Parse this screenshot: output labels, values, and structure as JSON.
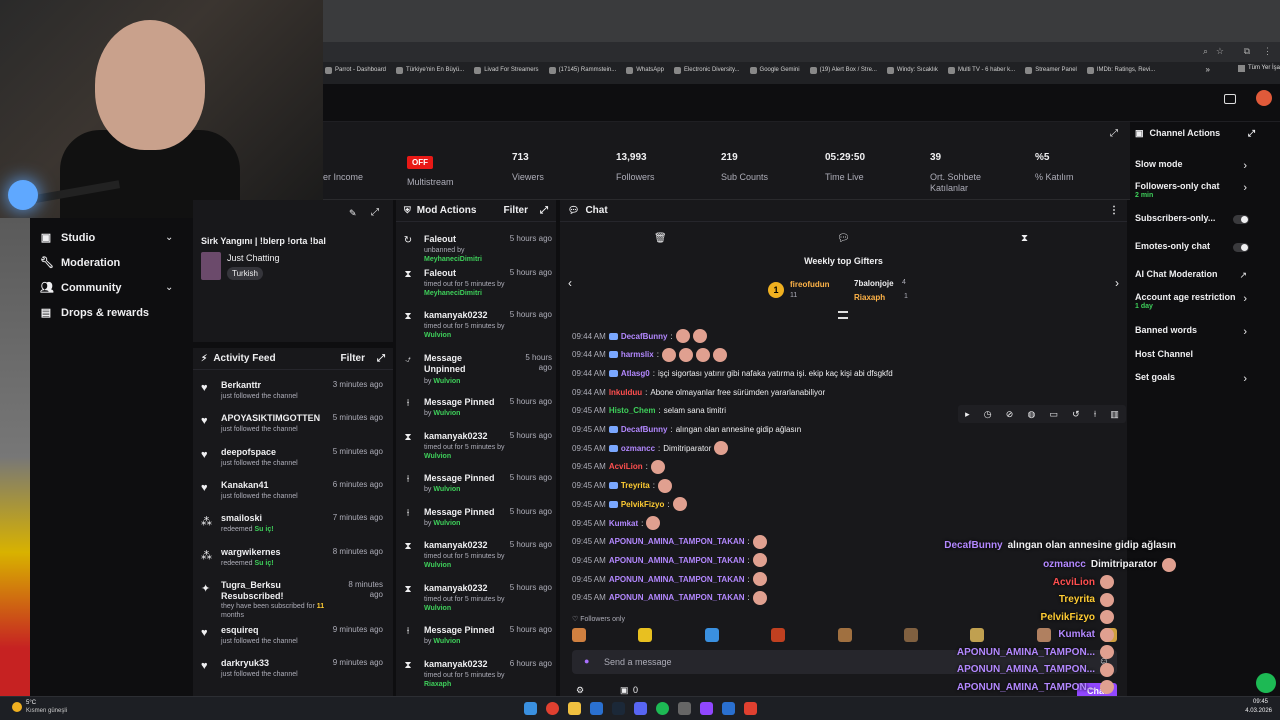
{
  "browser": {
    "bookmarks": [
      "Parrot - Dashboard",
      "Türkiye'nin En Büyü...",
      "Livad For Streamers",
      "(17145) Rammstein...",
      "WhatsApp",
      "Electronic Diversity...",
      "Google Gemini",
      "(19) Alert Box / Stre...",
      "Windy: Sıcaklık",
      "Multi TV - 6 haber k...",
      "Streamer Panel",
      "IMDb: Ratings, Revi..."
    ],
    "more": "»",
    "other_bookmarks": "Tüm Yer İşa"
  },
  "stats": {
    "income_label": "er Income",
    "multistream_badge": "OFF",
    "multistream_label": "Multistream",
    "viewers": "713",
    "viewers_label": "Viewers",
    "followers": "13,993",
    "followers_label": "Followers",
    "subs": "219",
    "subs_label": "Sub Counts",
    "time_live": "05:29:50",
    "time_live_label": "Time Live",
    "avg_chat": "39",
    "avg_chat_label": "Ort. Sohbete Katılanlar",
    "participation": "%5",
    "participation_label": "% Katılım"
  },
  "sidebar": {
    "items": [
      {
        "label": "Studio",
        "icon": "video-icon"
      },
      {
        "label": "Moderation",
        "icon": "wrench-icon"
      },
      {
        "label": "Community",
        "icon": "people-icon"
      },
      {
        "label": "Drops & rewards",
        "icon": "gift-icon"
      }
    ]
  },
  "stream_info": {
    "title": "Sirk Yangını | !blerp !orta !bal",
    "category": "Just Chatting",
    "language": "Turkish"
  },
  "activity_feed": {
    "title": "Activity Feed",
    "filter": "Filter",
    "items": [
      {
        "name": "Berkanttr",
        "sub": "just followed the channel",
        "time": "3 minutes ago",
        "type": "follow"
      },
      {
        "name": "APOYASIKTIMGOTTEN",
        "sub": "just followed the channel",
        "time": "5 minutes ago",
        "type": "follow"
      },
      {
        "name": "deepofspace",
        "sub": "just followed the channel",
        "time": "5 minutes ago",
        "type": "follow"
      },
      {
        "name": "Kanakan41",
        "sub": "just followed the channel",
        "time": "6 minutes ago",
        "type": "follow"
      },
      {
        "name": "smailoski",
        "sub": "redeemed",
        "reward": "Su iç!",
        "time": "7 minutes ago",
        "type": "redeem"
      },
      {
        "name": "wargwikernes",
        "sub": "redeemed",
        "reward": "Su iç!",
        "time": "8 minutes ago",
        "type": "redeem"
      },
      {
        "name": "Tugra_Berksu Resubscribed!",
        "sub": "they have been subscribed for",
        "months": "11",
        "months_label": "months",
        "time": "8 minutes ago",
        "type": "sub"
      },
      {
        "name": "esquireq",
        "sub": "just followed the channel",
        "time": "9 minutes ago",
        "type": "follow"
      },
      {
        "name": "darkryuk33",
        "sub": "just followed the channel",
        "time": "9 minutes ago",
        "type": "follow"
      }
    ]
  },
  "mod_actions": {
    "title": "Mod Actions",
    "filter": "Filter",
    "items": [
      {
        "action": "Faleout",
        "detail": "unbanned by",
        "by": "MeyhaneciDimitri",
        "time": "5 hours ago",
        "icon": "undo-icon"
      },
      {
        "action": "Faleout",
        "detail": "timed out for 5 minutes by",
        "by": "MeyhaneciDimitri",
        "time": "5 hours ago",
        "icon": "hourglass-icon"
      },
      {
        "action": "kamanyak0232",
        "detail": "timed out for 5 minutes by",
        "by": "Wulvion",
        "time": "5 hours ago",
        "icon": "hourglass-icon"
      },
      {
        "action": "Message Unpinned",
        "detail": "by",
        "by": "Wulvion",
        "time": "5 hours ago",
        "icon": "unpin-icon"
      },
      {
        "action": "Message Pinned",
        "detail": "by",
        "by": "Wulvion",
        "time": "5 hours ago",
        "icon": "pin-icon"
      },
      {
        "action": "kamanyak0232",
        "detail": "timed out for 5 minutes by",
        "by": "Wulvion",
        "time": "5 hours ago",
        "icon": "hourglass-icon"
      },
      {
        "action": "Message Pinned",
        "detail": "by",
        "by": "Wulvion",
        "time": "5 hours ago",
        "icon": "pin-icon"
      },
      {
        "action": "Message Pinned",
        "detail": "by",
        "by": "Wulvion",
        "time": "5 hours ago",
        "icon": "pin-icon"
      },
      {
        "action": "kamanyak0232",
        "detail": "timed out for 5 minutes by",
        "by": "Wulvion",
        "time": "5 hours ago",
        "icon": "hourglass-icon"
      },
      {
        "action": "kamanyak0232",
        "detail": "timed out for 5 minutes by",
        "by": "Wulvion",
        "time": "5 hours ago",
        "icon": "hourglass-icon"
      },
      {
        "action": "Message Pinned",
        "detail": "by",
        "by": "Wulvion",
        "time": "5 hours ago",
        "icon": "pin-icon"
      },
      {
        "action": "kamanyak0232",
        "detail": "timed out for 5 minutes by",
        "by": "Riaxaph",
        "time": "6 hours ago",
        "icon": "hourglass-icon"
      }
    ]
  },
  "chat": {
    "title": "Chat",
    "gifters_title": "Weekly top Gifters",
    "gifters": [
      {
        "name": "fireofudun",
        "count": "11"
      },
      {
        "name": "7balonjoje",
        "count": "4"
      },
      {
        "name": "Riaxaph",
        "count": "1"
      }
    ],
    "messages": [
      {
        "time": "09:44 AM",
        "user": "DecafBunny",
        "color": "#b388ff",
        "text": "",
        "emotes": 2
      },
      {
        "time": "09:44 AM",
        "user": "harmslix",
        "color": "#b388ff",
        "text": "",
        "emotes": 4
      },
      {
        "time": "09:44 AM",
        "user": "Atlasg0",
        "color": "#b388ff",
        "text": "işçi sigortası yatırır gibi nafaka yatırma işi. ekip kaç kişi abi dfsgkfd",
        "emotes": 0
      },
      {
        "time": "09:44 AM",
        "user": "lnkulduu",
        "color": "#ff4f4f",
        "text": "Abone olmayanlar free sürümden yararlanabiliyor",
        "emotes": 0
      },
      {
        "time": "09:45 AM",
        "user": "Histo_Chem",
        "color": "#3ecf5a",
        "text": "selam sana timitri",
        "emotes": 0
      },
      {
        "time": "09:45 AM",
        "user": "DecafBunny",
        "color": "#b388ff",
        "text": "alıngan olan annesine gidip ağlasın",
        "emotes": 0
      },
      {
        "time": "09:45 AM",
        "user": "ozmancc",
        "color": "#b388ff",
        "text": "Dimitriparator",
        "emotes": 1
      },
      {
        "time": "09:45 AM",
        "user": "AcviLion",
        "color": "#ff4f4f",
        "text": "",
        "emotes": 1
      },
      {
        "time": "09:45 AM",
        "user": "Treyrita",
        "color": "#ffcc33",
        "text": "",
        "emotes": 1
      },
      {
        "time": "09:45 AM",
        "user": "PelvikFizyo",
        "color": "#ffcc33",
        "text": "",
        "emotes": 1
      },
      {
        "time": "09:45 AM",
        "user": "Kumkat",
        "color": "#b388ff",
        "text": "",
        "emotes": 1
      },
      {
        "time": "09:45 AM",
        "user": "APONUN_AMINA_TAMPON_TAKAN",
        "color": "#b388ff",
        "text": "",
        "emotes": 1
      },
      {
        "time": "09:45 AM",
        "user": "APONUN_AMINA_TAMPON_TAKAN",
        "color": "#b388ff",
        "text": "",
        "emotes": 1
      },
      {
        "time": "09:45 AM",
        "user": "APONUN_AMINA_TAMPON_TAKAN",
        "color": "#b388ff",
        "text": "",
        "emotes": 1
      },
      {
        "time": "09:45 AM",
        "user": "APONUN_AMINA_TAMPON_TAKAN",
        "color": "#b388ff",
        "text": "",
        "emotes": 1
      }
    ],
    "followers_only": "Followers only",
    "placeholder": "Send a message",
    "points": "0",
    "send": "Chat"
  },
  "channel_actions": {
    "title": "Channel Actions",
    "items": [
      {
        "label": "Slow mode",
        "sub": "",
        "control": "arrow"
      },
      {
        "label": "Followers-only chat",
        "sub": "2 min",
        "control": "arrow"
      },
      {
        "label": "Subscribers-only...",
        "sub": "",
        "control": "toggle"
      },
      {
        "label": "Emotes-only chat",
        "sub": "",
        "control": "toggle"
      },
      {
        "label": "AI Chat Moderation",
        "sub": "",
        "control": "external"
      },
      {
        "label": "Account age restriction",
        "sub": "1 day",
        "control": "arrow"
      },
      {
        "label": "Banned words",
        "sub": "",
        "control": "arrow"
      },
      {
        "label": "Host Channel",
        "sub": "",
        "control": "none"
      },
      {
        "label": "Set goals",
        "sub": "",
        "control": "arrow"
      }
    ]
  },
  "overlay": [
    {
      "user": "DecafBunny",
      "color": "#b388ff",
      "text": "alıngan olan annesine gidip ağlasın"
    },
    {
      "user": "ozmancc",
      "color": "#b388ff",
      "text": "Dimitriparator"
    },
    {
      "user": "AcviLion",
      "color": "#ff4f4f",
      "text": ""
    },
    {
      "user": "Treyrita",
      "color": "#ffcc33",
      "text": ""
    },
    {
      "user": "PelvikFizyo",
      "color": "#ffcc33",
      "text": ""
    },
    {
      "user": "Kumkat",
      "color": "#b388ff",
      "text": ""
    },
    {
      "user": "APONUN_AMINA_TAMPON...",
      "color": "#b388ff",
      "text": ""
    },
    {
      "user": "APONUN_AMINA_TAMPON...",
      "color": "#b388ff",
      "text": ""
    },
    {
      "user": "APONUN_AMINA_TAMPON...",
      "color": "#b388ff",
      "text": ""
    }
  ],
  "taskbar": {
    "weather_temp": "5°C",
    "weather_text": "Kısmen güneşli",
    "time": "09:45",
    "date": "4.03.2026"
  }
}
